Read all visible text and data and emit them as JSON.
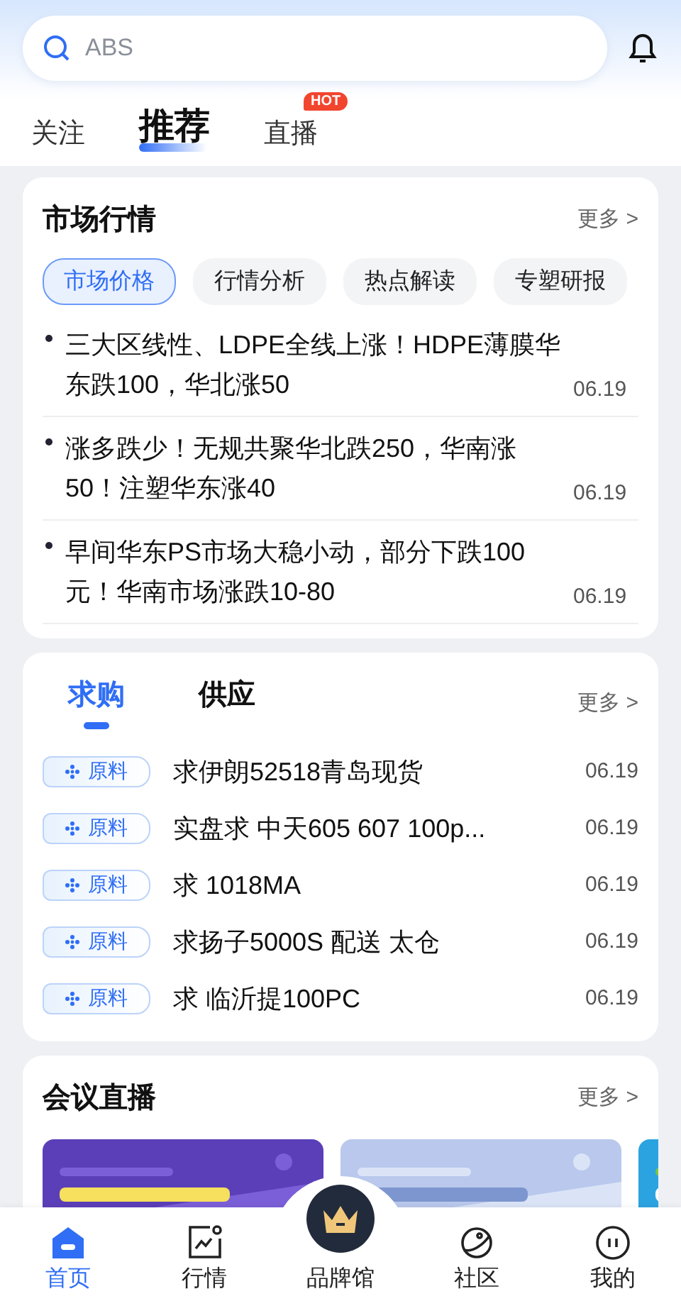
{
  "search": {
    "placeholder": "ABS"
  },
  "tabs": [
    {
      "label": "关注",
      "selected": false
    },
    {
      "label": "推荐",
      "selected": true
    },
    {
      "label": "直播",
      "selected": false,
      "badge": "HOT"
    }
  ],
  "market": {
    "title": "市场行情",
    "more": "更多 >",
    "chips": [
      {
        "label": "市场价格",
        "selected": true
      },
      {
        "label": "行情分析",
        "selected": false
      },
      {
        "label": "热点解读",
        "selected": false
      },
      {
        "label": "专塑研报",
        "selected": false
      }
    ],
    "news": [
      {
        "text": "三大区线性、LDPE全线上涨！HDPE薄膜华东跌100，华北涨50",
        "date": "06.19"
      },
      {
        "text": "涨多跌少！无规共聚华北跌250，华南涨50！注塑华东涨40",
        "date": "06.19"
      },
      {
        "text": "早间华东PS市场大稳小动，部分下跌100元！华南市场涨跌10-80",
        "date": "06.19"
      }
    ]
  },
  "trade": {
    "tabs": [
      {
        "label": "求购",
        "selected": true
      },
      {
        "label": "供应",
        "selected": false
      }
    ],
    "more": "更多 >",
    "rows": [
      {
        "tag": "原料",
        "text": "求伊朗52518青岛现货",
        "date": "06.19"
      },
      {
        "tag": "原料",
        "text": "实盘求 中天605 607 100p...",
        "date": "06.19"
      },
      {
        "tag": "原料",
        "text": "求 1018MA",
        "date": "06.19"
      },
      {
        "tag": "原料",
        "text": "求扬子5000S 配送 太仓",
        "date": "06.19"
      },
      {
        "tag": "原料",
        "text": "求 临沂提100PC",
        "date": "06.19"
      }
    ]
  },
  "meeting": {
    "title": "会议直播",
    "more": "更多 >"
  },
  "nav": [
    {
      "label": "首页",
      "kind": "home",
      "selected": true
    },
    {
      "label": "行情",
      "kind": "chart",
      "selected": false
    },
    {
      "label": "品牌馆",
      "kind": "crown",
      "selected": false
    },
    {
      "label": "社区",
      "kind": "planet",
      "selected": false
    },
    {
      "label": "我的",
      "kind": "face",
      "selected": false
    }
  ]
}
